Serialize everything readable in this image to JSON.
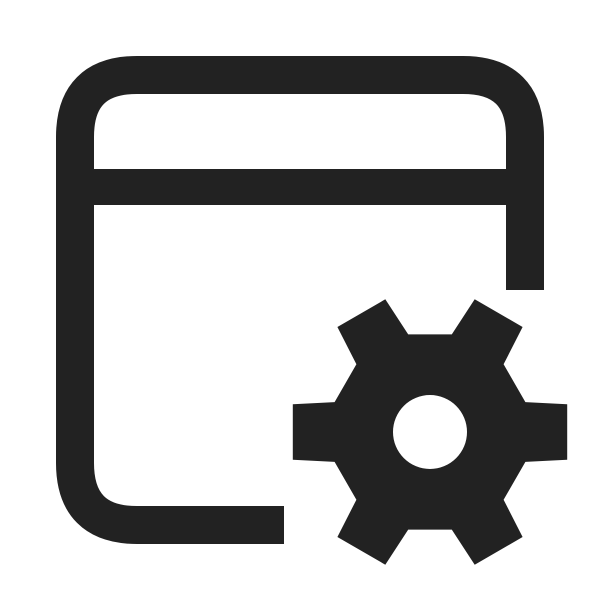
{
  "icon": {
    "name": "window-settings-icon",
    "parts": [
      "window-frame",
      "title-bar-divider",
      "gear"
    ],
    "color": "#222222",
    "background": "#ffffff"
  }
}
